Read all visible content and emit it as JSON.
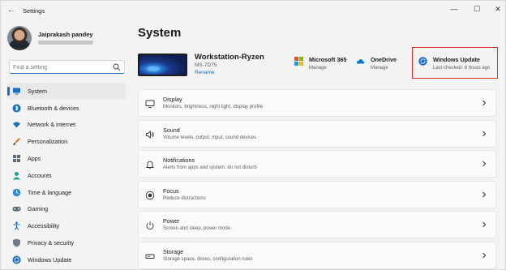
{
  "window": {
    "title": "Settings",
    "back_glyph": "←",
    "min_glyph": "—",
    "max_glyph": "☐",
    "close_glyph": "✕"
  },
  "profile": {
    "name": "Jaiprakash pandey"
  },
  "search": {
    "placeholder": "Find a setting"
  },
  "sidebar": {
    "items": [
      {
        "label": "System",
        "icon": "monitor-icon",
        "active": true
      },
      {
        "label": "Bluetooth & devices",
        "icon": "bluetooth-icon"
      },
      {
        "label": "Network & internet",
        "icon": "wifi-icon"
      },
      {
        "label": "Personalization",
        "icon": "brush-icon"
      },
      {
        "label": "Apps",
        "icon": "apps-icon"
      },
      {
        "label": "Accounts",
        "icon": "person-icon"
      },
      {
        "label": "Time & language",
        "icon": "globe-clock-icon"
      },
      {
        "label": "Gaming",
        "icon": "gamepad-icon"
      },
      {
        "label": "Accessibility",
        "icon": "accessibility-icon"
      },
      {
        "label": "Privacy & security",
        "icon": "shield-icon"
      },
      {
        "label": "Windows Update",
        "icon": "update-icon"
      }
    ]
  },
  "main": {
    "title": "System",
    "device": {
      "name": "Workstation-Ryzen",
      "model": "MS-7D75",
      "rename_label": "Rename"
    },
    "quick_links": [
      {
        "title": "Microsoft 365",
        "subtitle": "Manage",
        "icon": "microsoft-logo-icon"
      },
      {
        "title": "OneDrive",
        "subtitle": "Manage",
        "icon": "cloud-icon"
      },
      {
        "title": "Windows Update",
        "subtitle": "Last checked: 8 hours ago",
        "icon": "update-icon"
      }
    ],
    "cards": [
      {
        "title": "Display",
        "desc": "Monitors, brightness, night light, display profile",
        "icon": "display-icon"
      },
      {
        "title": "Sound",
        "desc": "Volume levels, output, input, sound devices",
        "icon": "speaker-icon"
      },
      {
        "title": "Notifications",
        "desc": "Alerts from apps and system, do not disturb",
        "icon": "bell-icon"
      },
      {
        "title": "Focus",
        "desc": "Reduce distractions",
        "icon": "focus-icon"
      },
      {
        "title": "Power",
        "desc": "Screen and sleep, power mode",
        "icon": "power-icon"
      },
      {
        "title": "Storage",
        "desc": "Storage space, drives, configuration rules",
        "icon": "storage-icon"
      }
    ]
  },
  "colors": {
    "accent": "#1a6fbf",
    "highlight_border": "#d32f2f",
    "background": "#f3f3f3",
    "card": "#fbfbfb"
  }
}
